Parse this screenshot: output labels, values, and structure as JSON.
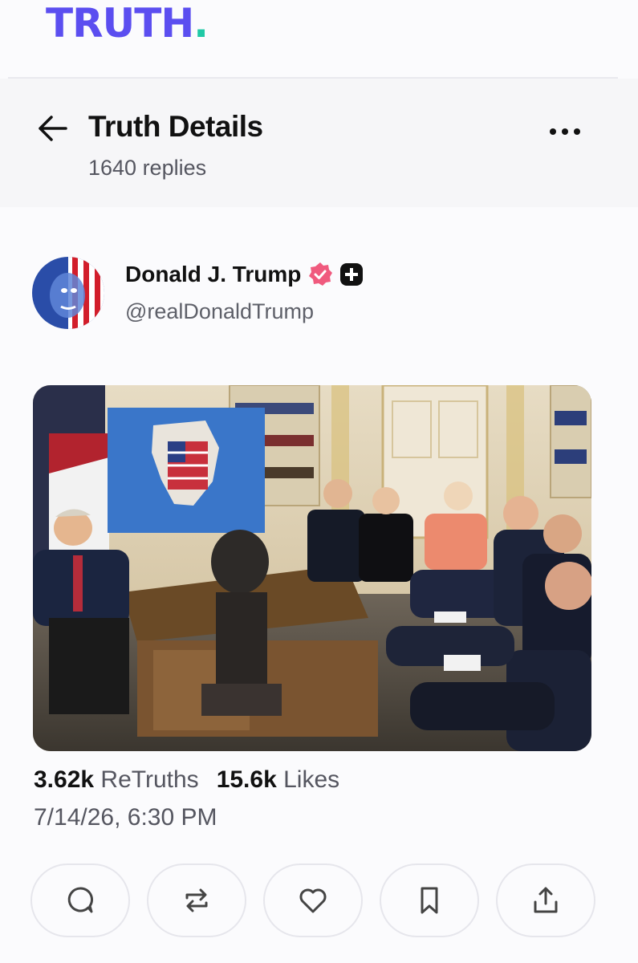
{
  "app": {
    "brand": "TRUTH",
    "brand_dot": ".",
    "brand_color": "#5b4ef0",
    "dot_color": "#20c9a6"
  },
  "header": {
    "title": "Truth Details",
    "replies": "1640 replies"
  },
  "author": {
    "name": "Donald J. Trump",
    "handle": "@realDonaldTrump",
    "verified_color": "#f05a7e"
  },
  "post": {
    "image_description_icon": "photo",
    "retruths_count": "3.62k",
    "retruths_label": "ReTruths",
    "likes_count": "15.6k",
    "likes_label": "Likes",
    "timestamp": "7/14/26, 6:30 PM"
  },
  "actions": [
    {
      "icon": "comment-icon"
    },
    {
      "icon": "retruth-icon"
    },
    {
      "icon": "like-icon"
    },
    {
      "icon": "bookmark-icon"
    },
    {
      "icon": "share-icon"
    }
  ]
}
